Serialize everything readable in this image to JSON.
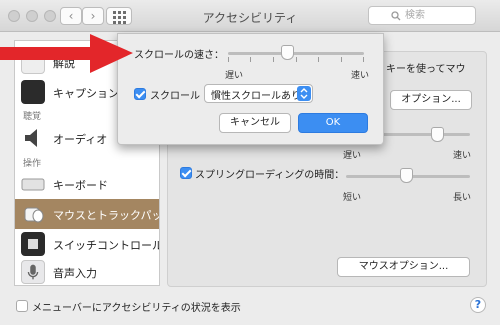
{
  "window": {
    "title": "アクセシビリティ",
    "search_placeholder": "検索"
  },
  "sidebar": {
    "items": [
      {
        "label": "解説",
        "icon": "speech-bubble-icon"
      },
      {
        "label": "キャプション",
        "icon": "captions-icon"
      },
      {
        "label": "オーディオ",
        "icon": "speaker-icon"
      },
      {
        "label": "キーボード",
        "icon": "keyboard-icon"
      },
      {
        "label": "マウスとトラックパッド",
        "icon": "mouse-icon",
        "selected": true
      },
      {
        "label": "スイッチコントロール",
        "icon": "switch-control-icon"
      },
      {
        "label": "音声入力",
        "icon": "microphone-icon"
      }
    ],
    "section_hearing": "聴覚",
    "section_interaction": "操作"
  },
  "main": {
    "partial_text": "キーを使ってマウ",
    "options_button": "オプション...",
    "double_click_slow": "遅い",
    "double_click_fast": "速い",
    "spring_loading_label": "スプリングローディングの時間：",
    "spring_short": "短い",
    "spring_long": "長い",
    "mouse_options_button": "マウスオプション..."
  },
  "popup": {
    "scroll_speed_label": "スクロールの速さ：",
    "slow": "遅い",
    "fast": "速い",
    "scroll_label": "スクロール",
    "scroll_mode": "慣性スクロールあり",
    "cancel": "キャンセル",
    "ok": "OK"
  },
  "footer": {
    "menubar_status": "メニューバーにアクセシビリティの状況を表示",
    "help": "?"
  },
  "colors": {
    "accent": "#3c8ef2",
    "selection": "#a48661",
    "arrow": "#e3262a"
  }
}
